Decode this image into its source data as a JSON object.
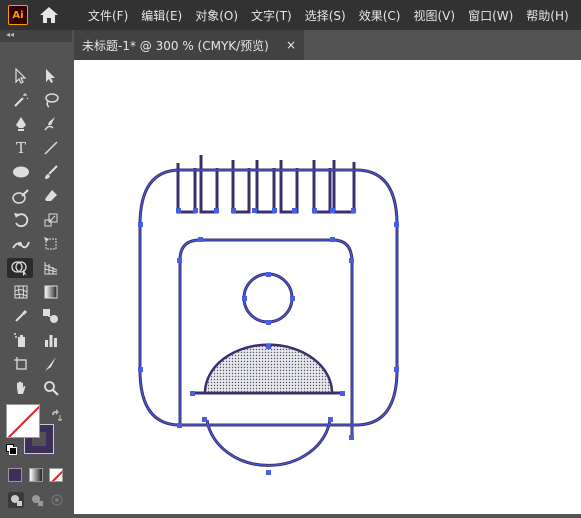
{
  "app": {
    "logo_text": "Ai"
  },
  "menu": [
    "文件(F)",
    "编辑(E)",
    "对象(O)",
    "文字(T)",
    "选择(S)",
    "效果(C)",
    "视图(V)",
    "窗口(W)",
    "帮助(H)"
  ],
  "toolbar": {
    "collapse_glyph": "◂◂",
    "type_tool_glyph": "T"
  },
  "document_tab": {
    "title": "未标题-1* @ 300 % (CMYK/预览)",
    "close_glyph": "×"
  },
  "colors": {
    "fill": "#ffffff",
    "stroke": "#3d2f5a",
    "swap": "#bbbbbb"
  }
}
